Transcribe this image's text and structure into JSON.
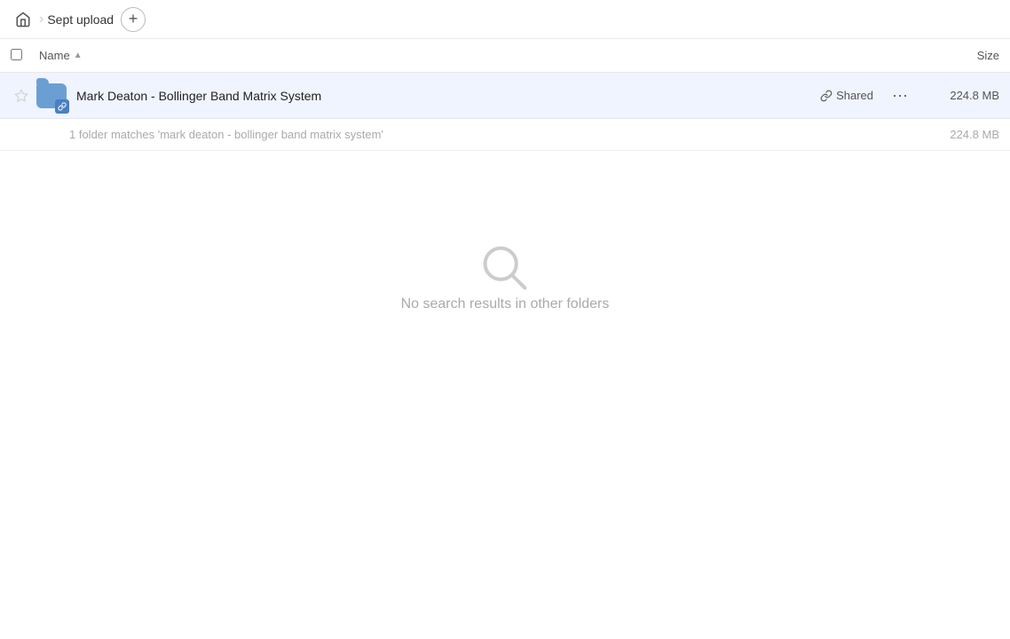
{
  "nav": {
    "home_icon": "home",
    "breadcrumb_sep": "›",
    "breadcrumb_label": "Sept upload",
    "add_btn_label": "+"
  },
  "columns": {
    "name_label": "Name",
    "sort_arrow": "▲",
    "size_label": "Size"
  },
  "file_row": {
    "name": "Mark Deaton - Bollinger Band Matrix System",
    "shared_label": "Shared",
    "more_icon": "···",
    "size": "224.8 MB"
  },
  "match_row": {
    "text": "1 folder matches 'mark deaton - bollinger band matrix system'",
    "size": "224.8 MB"
  },
  "empty_state": {
    "text": "No search results in other folders"
  }
}
